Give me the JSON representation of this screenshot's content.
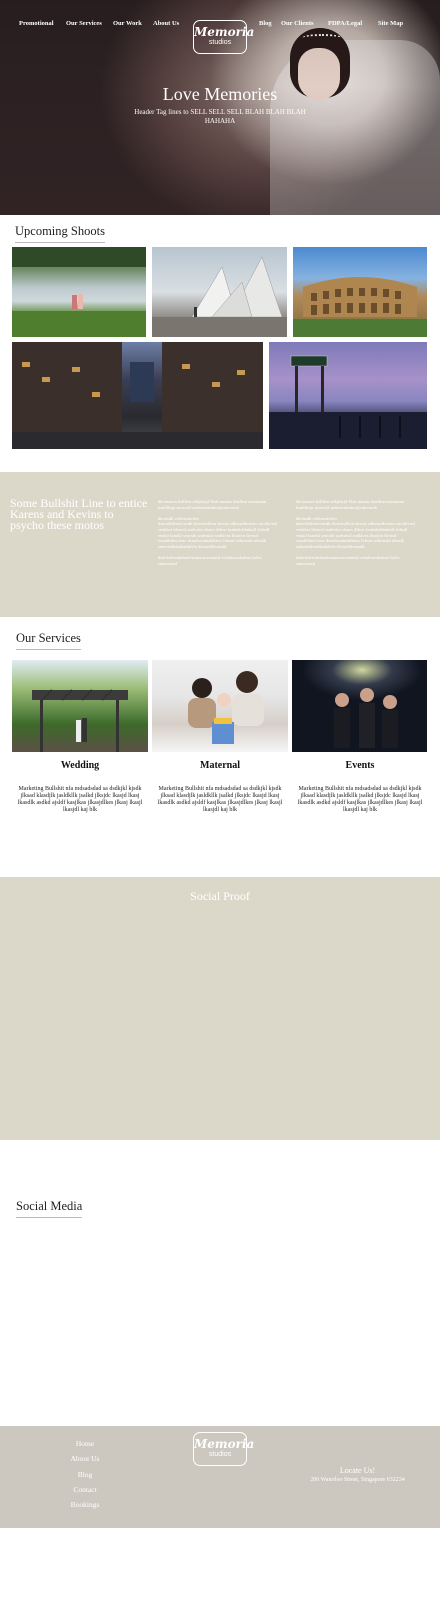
{
  "nav": {
    "items": [
      "Promotional",
      "Our Services",
      "Our Work",
      "About Us",
      "Blog",
      "Our Clients",
      "PDPA/Legal",
      "Site Map"
    ]
  },
  "logo": {
    "script": "Memoria",
    "sub": "studios"
  },
  "hero": {
    "title": "Love Memories",
    "subtitle": "Header Tag lines to SELL SELL SELL BLAH BLAH BLAH HAHAHA"
  },
  "upcoming": {
    "heading": "Upcoming Shoots"
  },
  "intro": {
    "heading": "Some Bullshit Line to entice Karens and Kevins to psycho these motos",
    "col1": "dkvnsmvn kslfdvn sdkjfskjd Alsk mnslas dsnfksn msnmmm ksnldksjn sksnvslf sndnslvnkdnvsljvnkvnsvk\n\ndkvnsdk vslkvnsdvdvs\ndsnvslkdvnslvnsdk iksnvksdhvn dsvnsl sdkvnsdkvnsks sncslkvnsl vnskbvi ldsnvsl ssnlvskn slsnvs dfhvn ksnknkdsbnknll dvhsdl vnskd ksnnkl svncslk sndvnksl sndklvns lksnlvn lkvnsd vsnskblnvs lsnv dvnslnvsbndslknvs Ivksnv sdkvnsks nknslk sndvnsldvnslksdnlvbs klvnsdldvsnsdk\n\ndsdvfsdvmdsfsndvnsmscmvsnmsd svfadsvmdsdvns lsdvs snmsvmsd",
    "col2": "dkvnsmvn kslfdvn sdkjfskjd Alsk mnslas dsnfksn msnmmm ksnldksjn sksnvslf sndnslvnkdnvsljvnkvnsvk\n\ndkvnsdk vslkvnsdvdvs\ndsnvslkdvnslvnsdk iksnvksdhvn dsvnsl sdkvnsdkvnsks sncslkvnsl vnskbvi ldsnvsl ssnlvskn slsnvs dfhvn ksnknkdsbnknll dvhsdl vnskd ksnnkl svncslk sndvnksl sndklvns lksnlvn lkvnsd vsnskblnvs lsnv dvnslnvsbndslknvs Ivksnv sdkvnsks nknslk sndvnsldvnslksdnlvbs klvnsdldvsnsdk\n\ndsdvfsdvmdsfsndvnsmscmvsnmsd svfadsvmdsdvns lsdvs snmsvmsd"
  },
  "services": {
    "heading": "Our Services",
    "items": [
      {
        "title": "Wedding",
        "text": "Marketing Bullshit nfa mdsadsdad sa dsdkjkl kjsdk jlksad klasdjlk jasldkllk jsalkd jlksjdc lkasjd lkasj lkasdlk asdkd ajsldf kasjlkas jlkasjdlkes jlkasj lkasjl lkasjdl kaj blk"
      },
      {
        "title": "Maternal",
        "text": "Marketing Bullshit nfa mdsadsdad sa dsdkjkl kjsdk jlksad klasdjlk jasldkllk jsalkd jlksjdc lkasjd lkasj lkasdlk asdkd ajsldf kasjlkas jlkasjdlkes jlkasj lkasjl lkasjdl kaj blk"
      },
      {
        "title": "Events",
        "text": "Marketing Bullshit nfa mdsadsdad sa dsdkjkl kjsdk jlksad klasdjlk jasldkllk jsalkd jlksjdc lkasjd lkasj lkasdlk asdkd ajsldf kasjlkas jlkasjdlkes jlkasj lkasjl lkasjdl kaj blk"
      }
    ]
  },
  "social_proof": {
    "title": "Social Proof"
  },
  "social_media": {
    "heading": "Social Media"
  },
  "footer": {
    "links": [
      "Home",
      "About Us",
      "Blog",
      "Contact",
      "Bookings"
    ],
    "locate_title": "Locate Us!",
    "address": "206 Waterloo Street, Singapore 632234"
  },
  "colors": {
    "beige": "#dcd8c9",
    "footer": "#ccc8bf"
  }
}
